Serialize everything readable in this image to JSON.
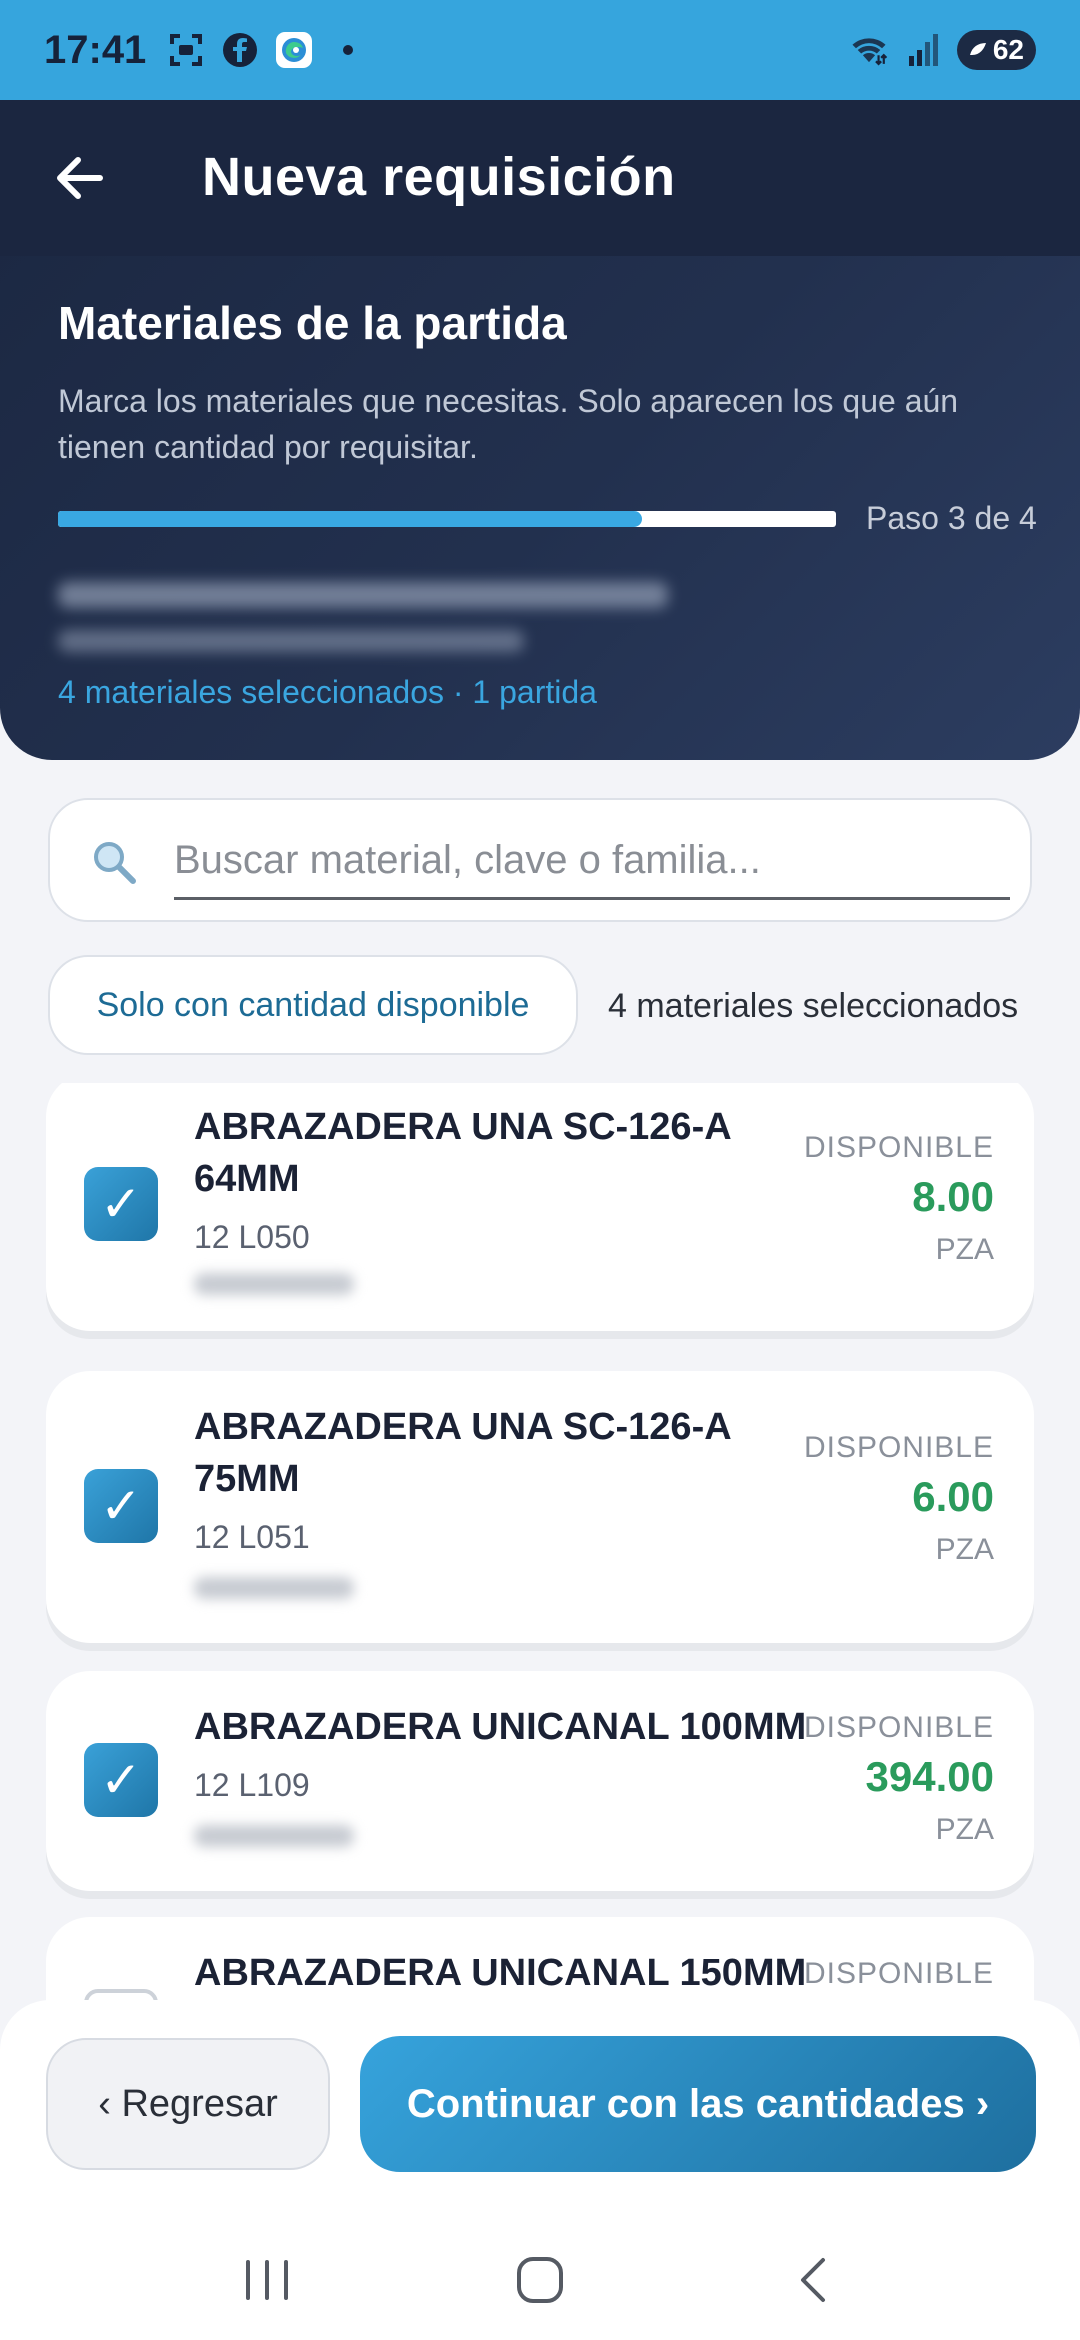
{
  "status_bar": {
    "time": "17:41",
    "battery": "62",
    "icons": [
      "screenshot-icon",
      "facebook-icon",
      "edge-icon",
      "notification-dot-icon",
      "wifi-icon",
      "signal-icon",
      "battery-icon"
    ]
  },
  "appbar": {
    "title": "Nueva requisición"
  },
  "section": {
    "title": "Materiales de la partida",
    "description": "Marca los materiales que necesitas. Solo aparecen los que aún tienen cantidad por requisitar.",
    "progress_fraction": 0.75,
    "step_label": "Paso 3 de 4",
    "summary": "4 materiales seleccionados · 1 partida"
  },
  "search": {
    "placeholder": "Buscar material, clave o familia...",
    "value": ""
  },
  "filters": {
    "chip_label": "Solo con cantidad disponible",
    "selected_count": "4 materiales seleccionados"
  },
  "materials": [
    {
      "name": "ABRAZADERA UNA SC-126-A 64MM",
      "code": "12 L050",
      "available_label": "DISPONIBLE",
      "available": "8.00",
      "unit": "PZA",
      "checked": true
    },
    {
      "name": "ABRAZADERA UNA SC-126-A 75MM",
      "code": "12 L051",
      "available_label": "DISPONIBLE",
      "available": "6.00",
      "unit": "PZA",
      "checked": true
    },
    {
      "name": "ABRAZADERA UNICANAL 100MM",
      "code": "12 L109",
      "available_label": "DISPONIBLE",
      "available": "394.00",
      "unit": "PZA",
      "checked": true
    },
    {
      "name": "ABRAZADERA UNICANAL 150MM",
      "code": "",
      "available_label": "DISPONIBLE",
      "available": "",
      "unit": "",
      "checked": false
    }
  ],
  "actions": {
    "back_label": "‹ Regresar",
    "continue_label": "Continuar con las cantidades ›"
  },
  "colors": {
    "status_bar": "#36a5dd",
    "header": "#1b2741",
    "accent": "#39a8e2",
    "available_value": "#2a9b5c"
  }
}
